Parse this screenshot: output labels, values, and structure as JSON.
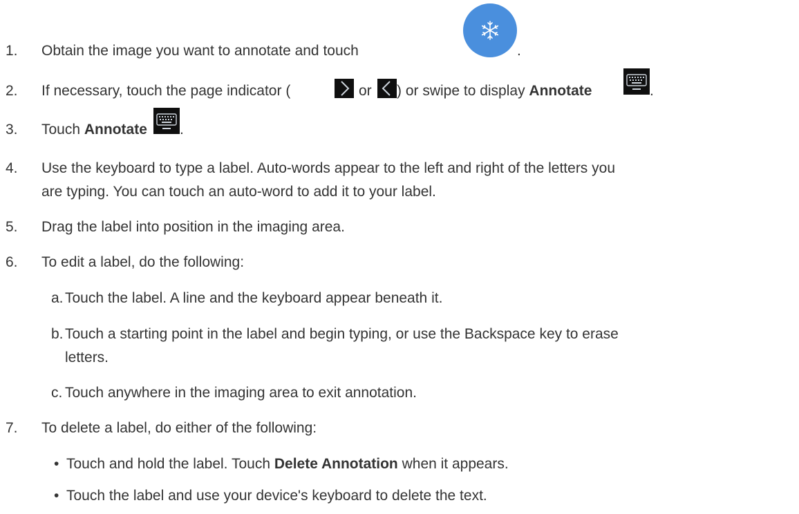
{
  "steps": [
    {
      "num": "1.",
      "text_a": "Obtain the image you want to annotate and touch",
      "text_b": "."
    },
    {
      "num": "2.",
      "text_a": "If necessary, touch the page indicator (",
      "text_or": "or",
      "text_b": ") or swipe to display",
      "bold": "Annotate",
      "text_c": "."
    },
    {
      "num": "3.",
      "text_a": "Touch",
      "bold": "Annotate",
      "text_b": "."
    },
    {
      "num": "4.",
      "line1": "Use the keyboard to type a label. Auto-words appear to the left and right of the letters you",
      "line2": "are typing. You can touch an auto-word to add it to your label."
    },
    {
      "num": "5.",
      "text": "Drag the label into position in the imaging area."
    },
    {
      "num": "6.",
      "text": "To edit a label, do the following:",
      "sub": [
        {
          "letter": "a.",
          "text": "Touch the label. A line and the keyboard appear beneath it."
        },
        {
          "letter": "b.",
          "line1": "Touch a starting point in the label and begin typing, or use the Backspace key to erase",
          "line2": "letters."
        },
        {
          "letter": "c.",
          "text": "Touch anywhere in the imaging area to exit annotation."
        }
      ]
    },
    {
      "num": "7.",
      "text": "To delete a label, do either of the following:",
      "bullets": [
        {
          "mark": "•",
          "text_a": "Touch and hold the label. Touch",
          "bold": "Delete Annotation",
          "text_b": "when it appears."
        },
        {
          "mark": "•",
          "text": "Touch the label and use your device's keyboard to delete the text."
        }
      ]
    }
  ],
  "icons": {
    "snowflake": "snowflake-icon",
    "next": "chevron-right-icon",
    "prev": "chevron-left-icon",
    "keyboard": "keyboard-icon"
  },
  "colors": {
    "text": "#333333",
    "freeze_button": "#4a8fdd",
    "icon_bg": "#0f0f0f"
  }
}
